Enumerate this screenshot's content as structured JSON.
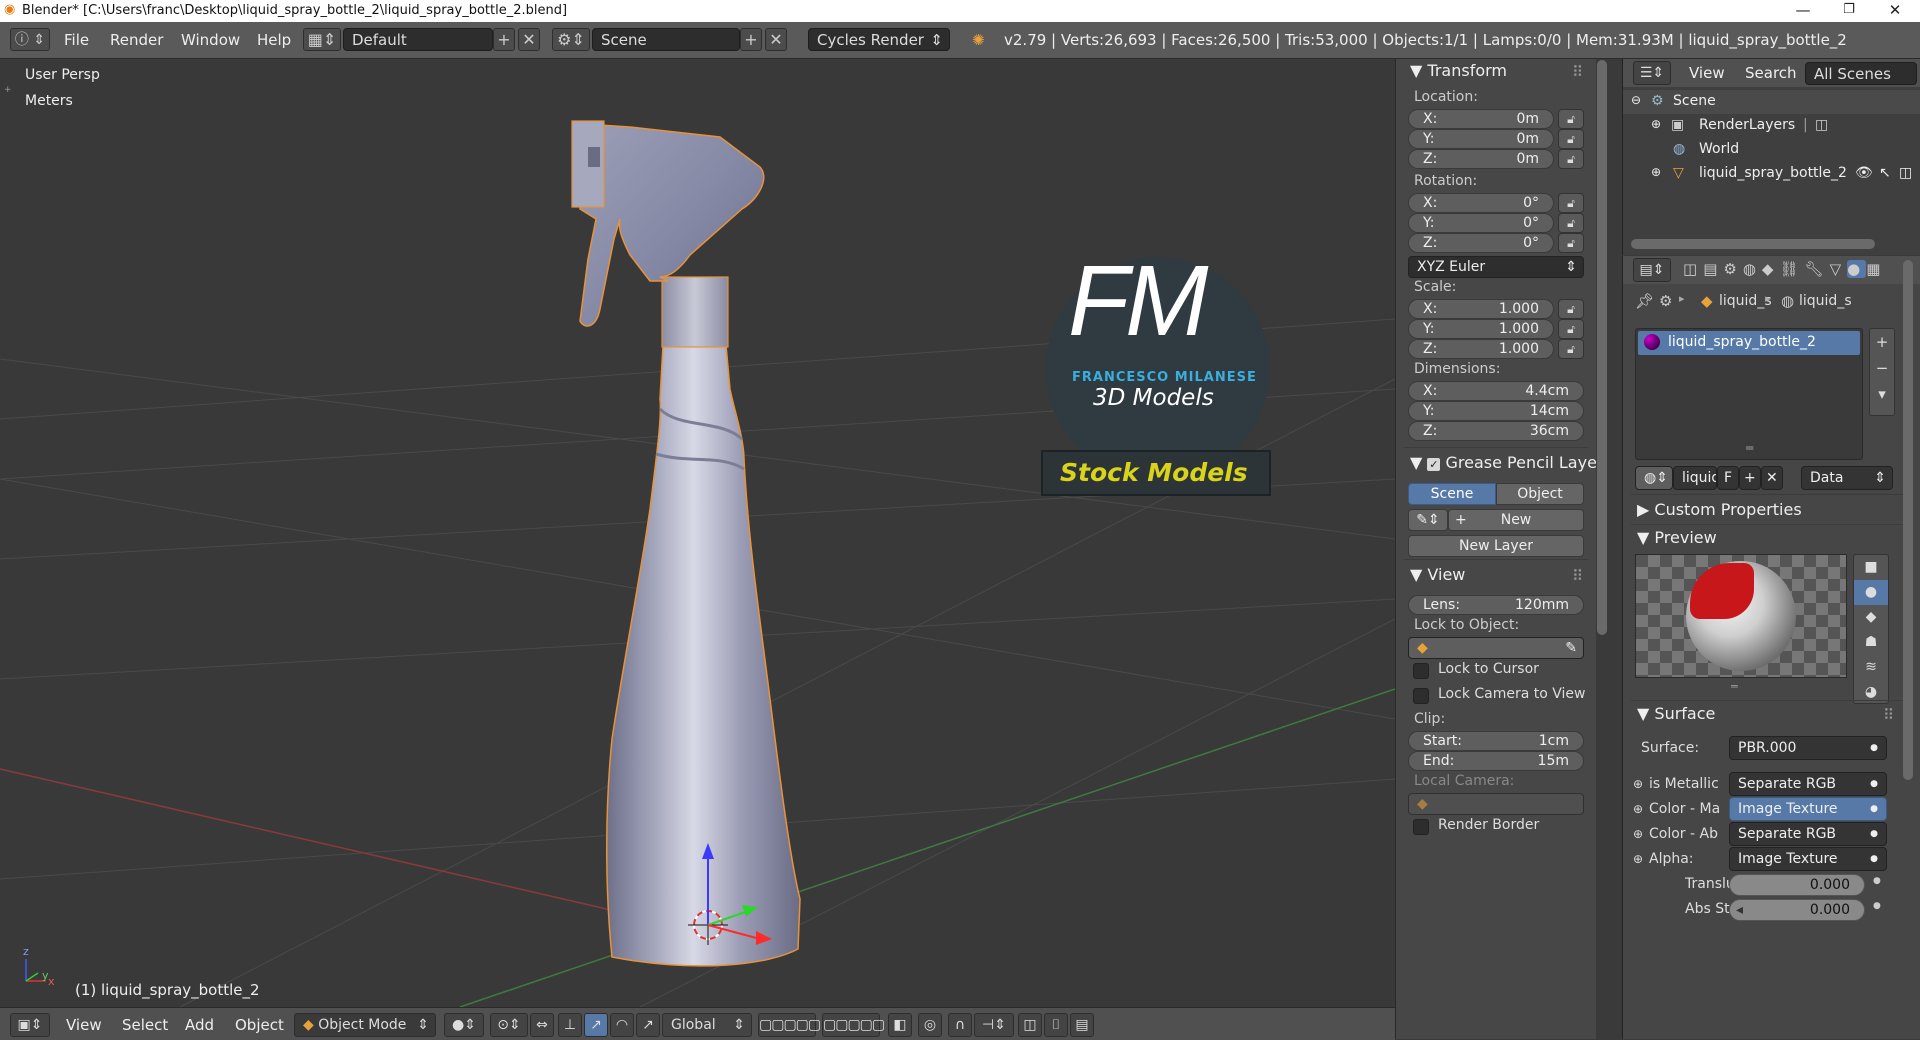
{
  "window": {
    "title": "Blender* [C:\\Users\\franc\\Desktop\\liquid_spray_bottle_2\\liquid_spray_bottle_2.blend]",
    "minimize": "—",
    "maximize": "❐",
    "close": "✕"
  },
  "infobar": {
    "menus": [
      "File",
      "Render",
      "Window",
      "Help"
    ],
    "layout": "Default",
    "scene": "Scene",
    "engine": "Cycles Render",
    "stats": "v2.79 | Verts:26,693 | Faces:26,500 | Tris:53,000 | Objects:1/1 | Lamps:0/0 | Mem:31.93M | liquid_spray_bottle_2"
  },
  "viewport": {
    "view_name": "User Persp",
    "units": "Meters",
    "object_label": "(1) liquid_spray_bottle_2",
    "watermark": {
      "initials": "FM",
      "author": "FRANCESCO MILANESE",
      "tagline": "3D Models",
      "banner": "Stock Models"
    }
  },
  "viewport_toolbar": {
    "menus": [
      "View",
      "Select",
      "Add",
      "Object"
    ],
    "mode": "Object Mode",
    "orientation": "Global"
  },
  "npanel": {
    "transform_title": "Transform",
    "location_label": "Location:",
    "location": [
      {
        "k": "X:",
        "v": "0m"
      },
      {
        "k": "Y:",
        "v": "0m"
      },
      {
        "k": "Z:",
        "v": "0m"
      }
    ],
    "rotation_label": "Rotation:",
    "rotation": [
      {
        "k": "X:",
        "v": "0°"
      },
      {
        "k": "Y:",
        "v": "0°"
      },
      {
        "k": "Z:",
        "v": "0°"
      }
    ],
    "rotation_mode": "XYZ Euler",
    "scale_label": "Scale:",
    "scale": [
      {
        "k": "X:",
        "v": "1.000"
      },
      {
        "k": "Y:",
        "v": "1.000"
      },
      {
        "k": "Z:",
        "v": "1.000"
      }
    ],
    "dimensions_label": "Dimensions:",
    "dimensions": [
      {
        "k": "X:",
        "v": "4.4cm"
      },
      {
        "k": "Y:",
        "v": "14cm"
      },
      {
        "k": "Z:",
        "v": "36cm"
      }
    ],
    "grease_title": "Grease Pencil Layer",
    "grease_scene": "Scene",
    "grease_object": "Object",
    "grease_new": "New",
    "grease_new_layer": "New Layer",
    "view_title": "View",
    "lens_key": "Lens:",
    "lens_val": "120mm",
    "lock_to_object": "Lock to Object:",
    "lock_to_cursor": "Lock to Cursor",
    "lock_camera": "Lock Camera to View",
    "clip_label": "Clip:",
    "clip_start_key": "Start:",
    "clip_start_val": "1cm",
    "clip_end_key": "End:",
    "clip_end_val": "15m",
    "local_camera": "Local Camera:",
    "render_border": "Render Border"
  },
  "outliner": {
    "menu_view": "View",
    "menu_search": "Search",
    "filter": "All Scenes",
    "items": [
      "Scene",
      "RenderLayers",
      "World",
      "liquid_spray_bottle_2"
    ]
  },
  "properties": {
    "crumb1": "liquid_s",
    "crumb2": "liquid_s",
    "material_slot": "liquid_spray_bottle_2",
    "material_name": "liquid",
    "fake_user": "F",
    "link": "Data",
    "custom_props": "Custom Properties",
    "preview": "Preview",
    "surface_title": "Surface",
    "surface_label": "Surface:",
    "surface_value": "PBR.000",
    "inputs": [
      {
        "label": "is Metallic",
        "value": "Separate RGB"
      },
      {
        "label": "Color - Ma",
        "value": "Image Texture"
      },
      {
        "label": "Color - Ab",
        "value": "Separate RGB"
      },
      {
        "label": "Alpha:",
        "value": "Image Texture"
      }
    ],
    "transluce_label": "Transluce",
    "transluce_value": "0.000",
    "abs_label": "Abs Stren",
    "abs_value": "0.000"
  }
}
